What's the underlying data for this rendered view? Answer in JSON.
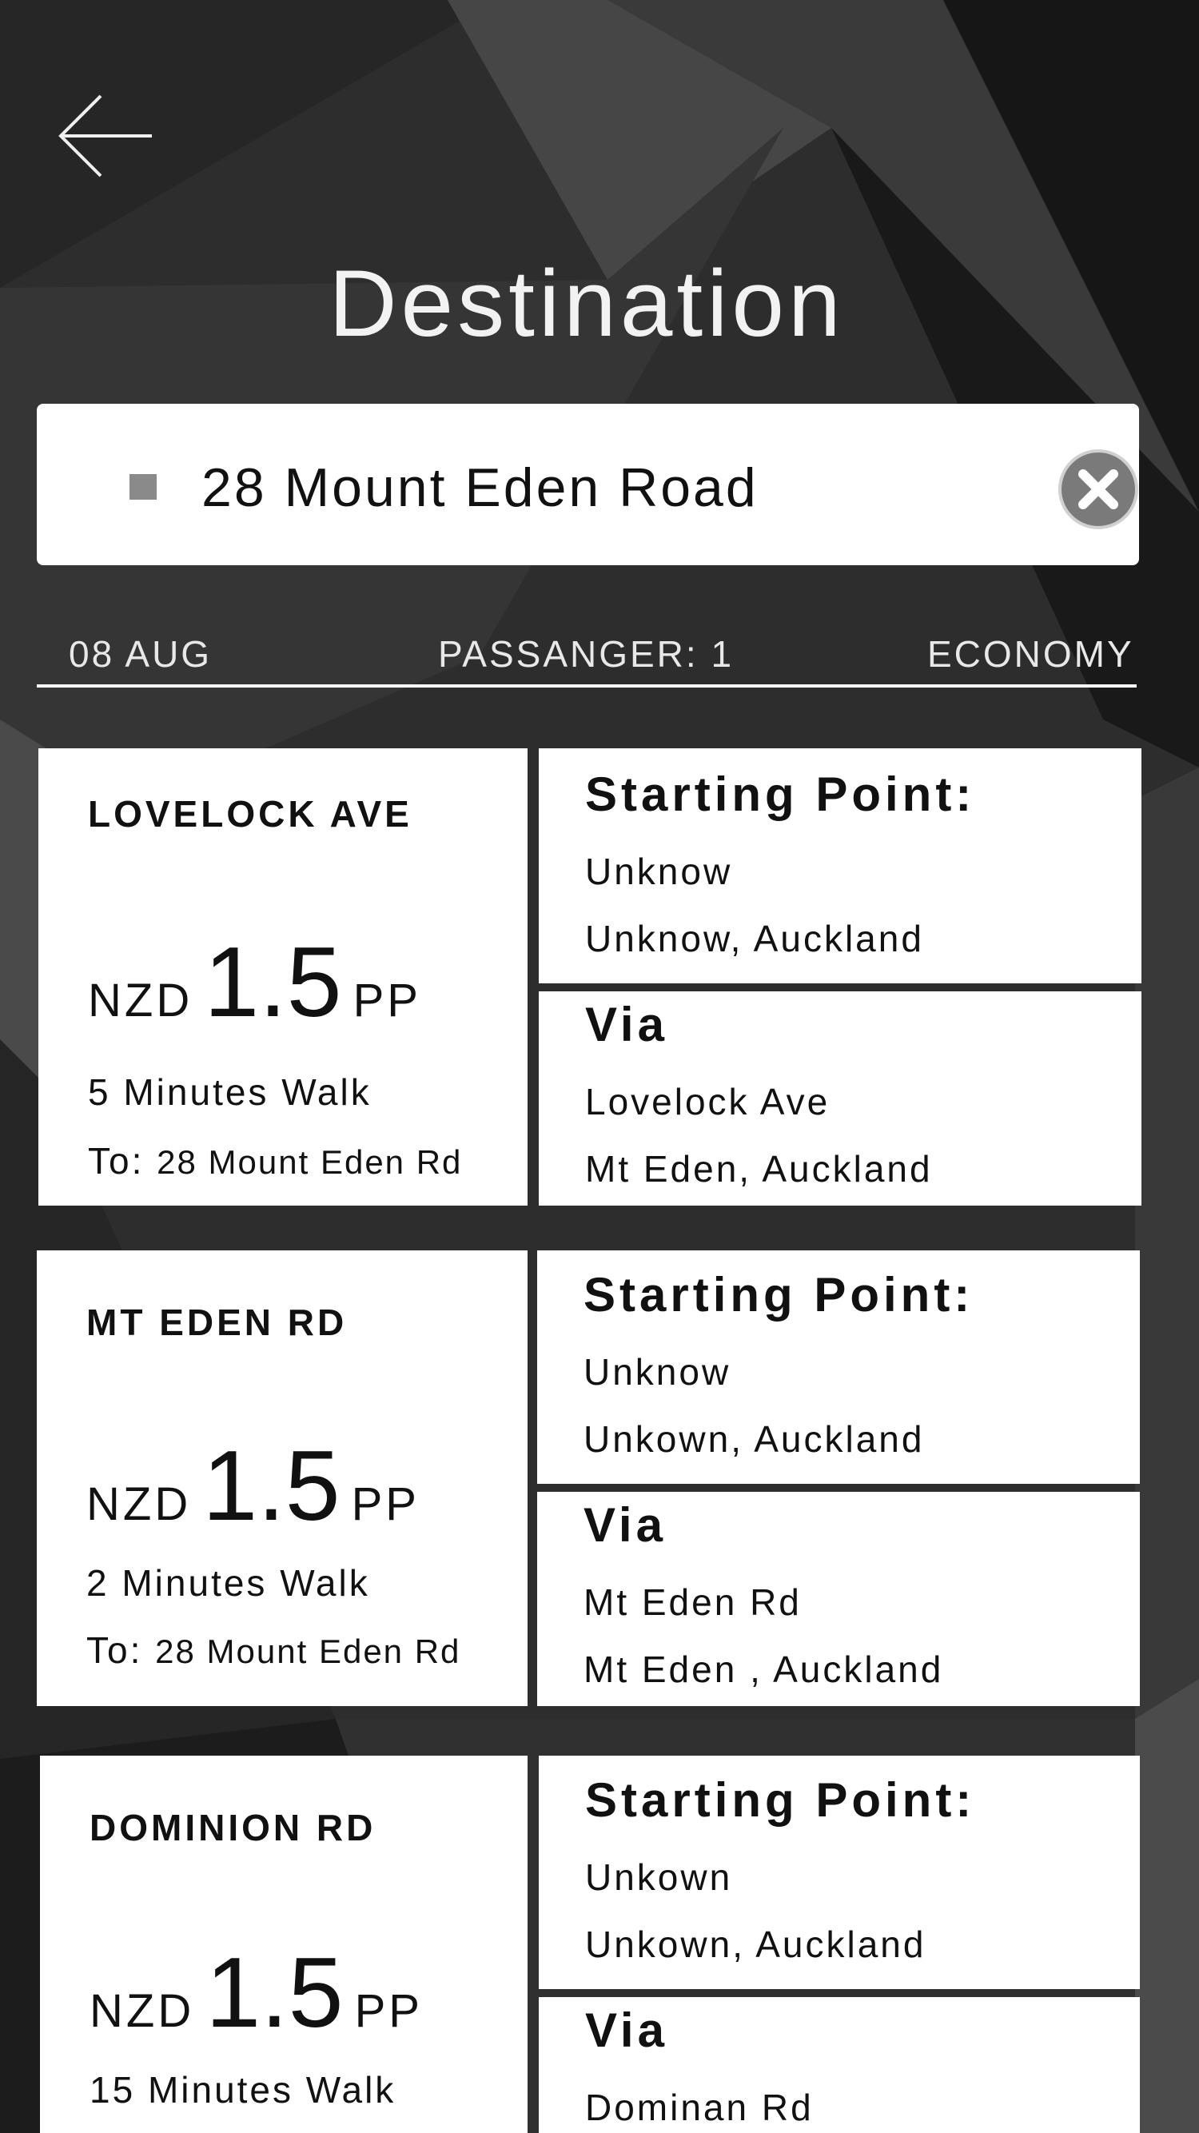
{
  "header": {
    "back_icon": "arrow-left-icon",
    "title": "Destination"
  },
  "search": {
    "value": "28 Mount Eden Road",
    "marker_icon": "square-marker-icon",
    "clear_icon": "close-circle-icon"
  },
  "trip_meta": {
    "date": "08 AUG",
    "passengers": "PASSANGER: 1",
    "class": "ECONOMY"
  },
  "routes": [
    {
      "street": "LOVELOCK AVE",
      "currency": "NZD",
      "price": "1.5",
      "unit": "PP",
      "walk": "5 Minutes Walk",
      "to_label": "To:",
      "to_address": "28 Mount Eden Rd",
      "start_heading": "Starting Point:",
      "start_line1": "Unknow",
      "start_line2": "Unknow, Auckland",
      "via_heading": "Via",
      "via_line1": "Lovelock Ave",
      "via_line2": "Mt Eden, Auckland"
    },
    {
      "street": "MT EDEN RD",
      "currency": "NZD",
      "price": "1.5",
      "unit": "PP",
      "walk": "2 Minutes Walk",
      "to_label": "To:",
      "to_address": "28 Mount Eden Rd",
      "start_heading": "Starting Point:",
      "start_line1": "Unknow",
      "start_line2": "Unkown, Auckland",
      "via_heading": "Via",
      "via_line1": "Mt Eden Rd",
      "via_line2": "Mt Eden , Auckland"
    },
    {
      "street": "DOMINION RD",
      "currency": "NZD",
      "price": "1.5",
      "unit": "PP",
      "walk": "15 Minutes Walk",
      "start_heading": "Starting Point:",
      "start_line1": "Unkown",
      "start_line2": "Unkown, Auckland",
      "via_heading": "Via",
      "via_line1": "Dominan Rd"
    }
  ],
  "colors": {
    "background": "#2e2e2e",
    "card": "#ffffff",
    "text_dark": "#111111",
    "clear_button": "#7a7a7a"
  }
}
